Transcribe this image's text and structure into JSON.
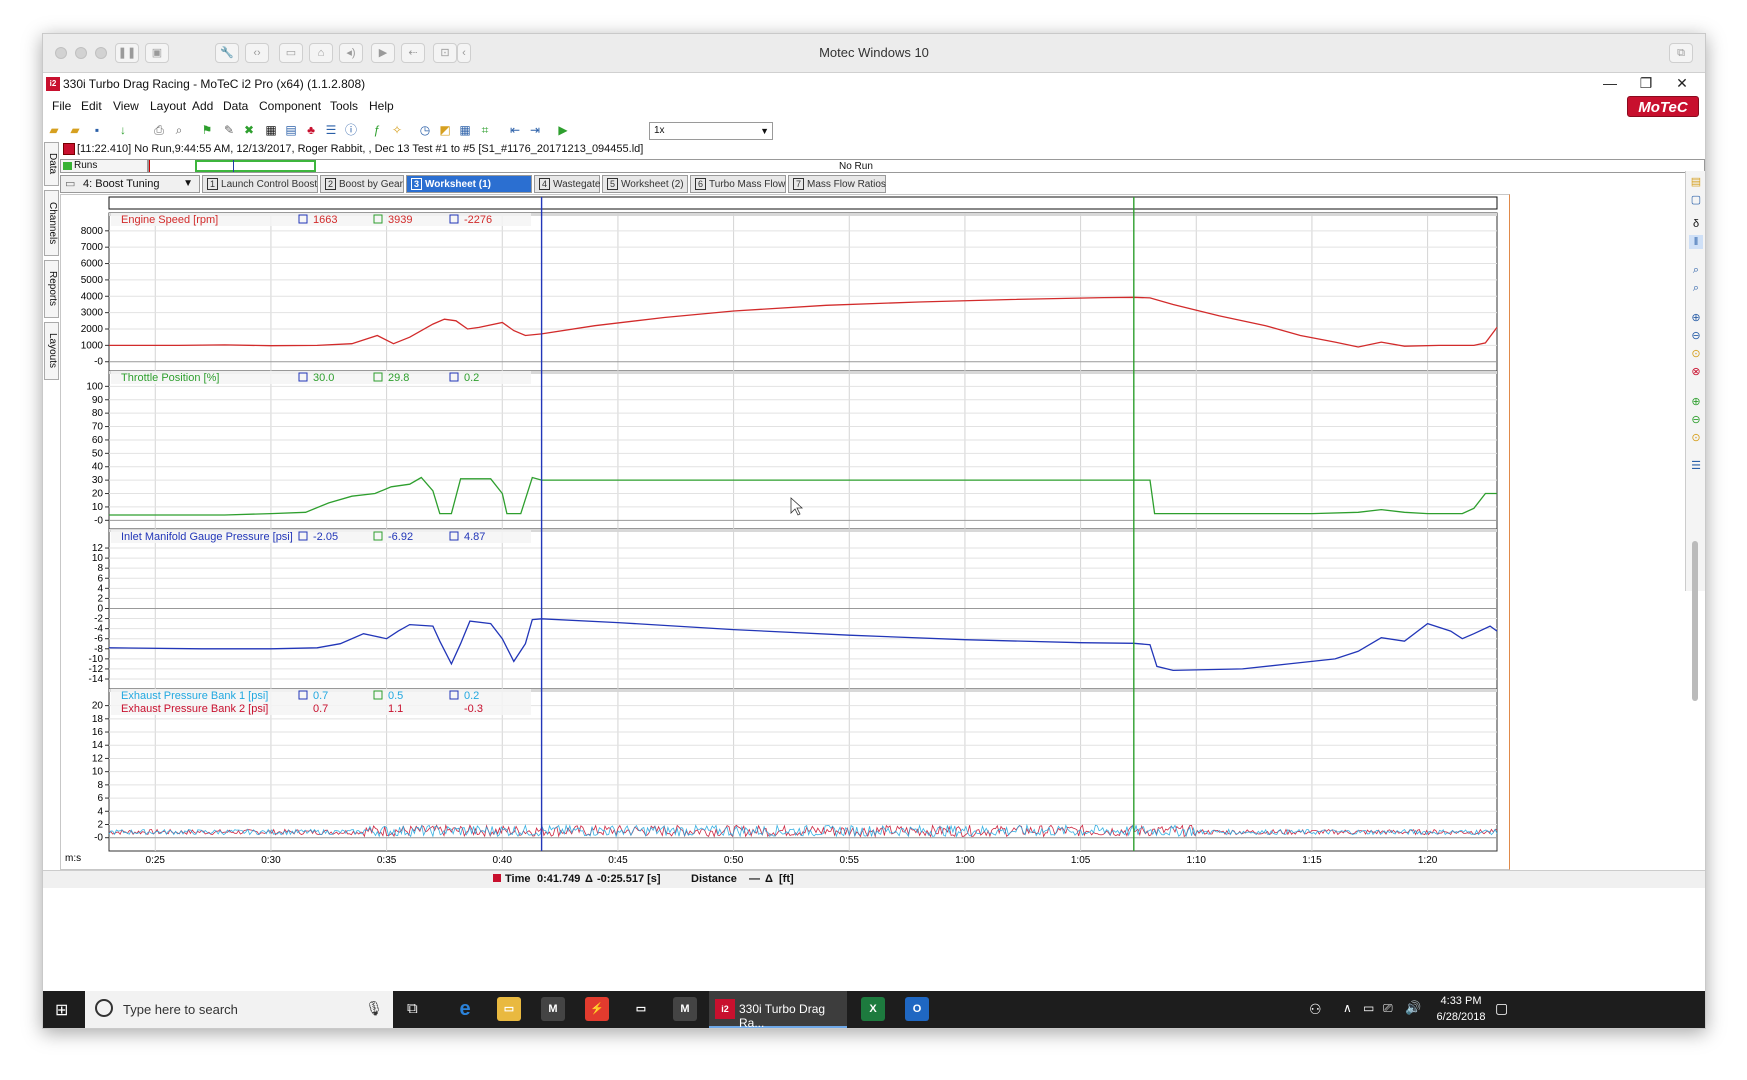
{
  "mac": {
    "title": "Motec Windows 10"
  },
  "window": {
    "title": "330i Turbo Drag Racing - MoTeC i2 Pro (x64) (1.1.2.808)",
    "logo": "MoTeC",
    "app_icon": "i2"
  },
  "menu": [
    "File",
    "Edit",
    "View",
    "Layout",
    "Add",
    "Data",
    "Component",
    "Tools",
    "Help"
  ],
  "toolbar": {
    "zoom": "1x"
  },
  "info": "[11:22.410] No Run,9:44:55 AM, 12/13/2017,  Roger Rabbit, , Dec 13 Test #1 to #5 [S1_#1176_20171213_094455.ld]",
  "left_tabs": [
    "Data",
    "Channels",
    "Reports",
    "Layouts"
  ],
  "runs": {
    "label": "Runs",
    "status": "No Run"
  },
  "worksheet_selector": "4: Boost Tuning",
  "tabs": [
    {
      "num": "1",
      "label": "Launch Control Boost",
      "active": false
    },
    {
      "num": "2",
      "label": "Boost by Gear",
      "active": false
    },
    {
      "num": "3",
      "label": "Worksheet (1)",
      "active": true
    },
    {
      "num": "4",
      "label": "Wastegate",
      "active": false
    },
    {
      "num": "5",
      "label": "Worksheet (2)",
      "active": false
    },
    {
      "num": "6",
      "label": "Turbo Mass Flow",
      "active": false
    },
    {
      "num": "7",
      "label": "Mass Flow Ratios",
      "active": false
    }
  ],
  "chart_data": {
    "type": "line",
    "x_unit": "m:s",
    "x_ticks": [
      "0:25",
      "0:30",
      "0:35",
      "0:40",
      "0:45",
      "0:50",
      "0:55",
      "1:00",
      "1:05",
      "1:10",
      "1:15",
      "1:20"
    ],
    "x_range": [
      "0:23",
      "1:23"
    ],
    "cursors": {
      "blue": "0:41.7",
      "green": "1:07.3"
    },
    "panes": [
      {
        "name": "Engine Speed [rpm]",
        "color": "#d22b2b",
        "cursor_a": "1663",
        "cursor_b": "3939",
        "delta": "-2276",
        "ylim": [
          -200,
          8600
        ],
        "y_ticks": [
          "8000",
          "7000",
          "6000",
          "5000",
          "4000",
          "3000",
          "2000",
          "1000",
          "-0"
        ],
        "points": [
          [
            23,
            1000
          ],
          [
            26,
            1000
          ],
          [
            28,
            1030
          ],
          [
            30,
            980
          ],
          [
            32,
            1000
          ],
          [
            33.5,
            1100
          ],
          [
            34.6,
            1600
          ],
          [
            35.3,
            1100
          ],
          [
            36,
            1500
          ],
          [
            37,
            2300
          ],
          [
            37.5,
            2600
          ],
          [
            38,
            2500
          ],
          [
            38.5,
            2000
          ],
          [
            39,
            2100
          ],
          [
            40,
            2400
          ],
          [
            40.5,
            1900
          ],
          [
            41,
            1600
          ],
          [
            41.7,
            1700
          ],
          [
            44,
            2200
          ],
          [
            47,
            2700
          ],
          [
            50,
            3100
          ],
          [
            54,
            3450
          ],
          [
            58,
            3650
          ],
          [
            62,
            3800
          ],
          [
            66,
            3920
          ],
          [
            67.3,
            3939
          ],
          [
            68,
            3900
          ],
          [
            69,
            3500
          ],
          [
            71,
            2800
          ],
          [
            73,
            2200
          ],
          [
            74.5,
            1600
          ],
          [
            76,
            1200
          ],
          [
            77,
            900
          ],
          [
            78,
            1200
          ],
          [
            79,
            950
          ],
          [
            80.5,
            1000
          ],
          [
            82,
            1000
          ],
          [
            82.5,
            1150
          ],
          [
            83,
            2100
          ]
        ]
      },
      {
        "name": "Throttle Position [%]",
        "color": "#2e9f2e",
        "cursor_a": "30.0",
        "cursor_b": "29.8",
        "delta": "0.2",
        "ylim": [
          -2,
          104
        ],
        "y_ticks": [
          "100",
          "90",
          "80",
          "70",
          "60",
          "50",
          "40",
          "30",
          "20",
          "10",
          "-0"
        ],
        "points": [
          [
            23,
            4
          ],
          [
            28,
            4
          ],
          [
            30,
            5
          ],
          [
            31.5,
            6
          ],
          [
            32.5,
            13
          ],
          [
            33.5,
            18
          ],
          [
            34.5,
            20
          ],
          [
            35.2,
            25
          ],
          [
            36,
            27
          ],
          [
            36.5,
            32
          ],
          [
            37,
            22
          ],
          [
            37.3,
            5
          ],
          [
            37.8,
            5
          ],
          [
            38.2,
            31
          ],
          [
            39.5,
            31
          ],
          [
            40,
            20
          ],
          [
            40.2,
            5
          ],
          [
            40.8,
            5
          ],
          [
            41.3,
            32
          ],
          [
            41.7,
            30
          ],
          [
            67.3,
            30
          ],
          [
            68,
            30
          ],
          [
            68.2,
            5
          ],
          [
            71,
            5
          ],
          [
            75,
            5
          ],
          [
            77,
            6
          ],
          [
            78,
            8
          ],
          [
            79,
            6
          ],
          [
            80,
            5
          ],
          [
            81.5,
            5
          ],
          [
            82,
            9
          ],
          [
            82.5,
            20
          ],
          [
            83,
            20
          ]
        ]
      },
      {
        "name": "Inlet Manifold Gauge Pressure [psi]",
        "color": "#2236b8",
        "cursor_a": "-2.05",
        "cursor_b": "-6.92",
        "delta": "4.87",
        "ylim": [
          -14,
          13
        ],
        "y_ticks": [
          "12",
          "10",
          "8",
          "6",
          "4",
          "2",
          "0",
          "-2",
          "-4",
          "-6",
          "-8",
          "-10",
          "-12",
          "-14"
        ],
        "points": [
          [
            23,
            -7.8
          ],
          [
            27,
            -8
          ],
          [
            30,
            -8
          ],
          [
            32,
            -7.8
          ],
          [
            33,
            -7
          ],
          [
            34,
            -5
          ],
          [
            35,
            -6
          ],
          [
            35.5,
            -4.5
          ],
          [
            36,
            -3.2
          ],
          [
            37,
            -3.5
          ],
          [
            37.3,
            -6.5
          ],
          [
            37.8,
            -11
          ],
          [
            38.2,
            -7
          ],
          [
            38.6,
            -2.5
          ],
          [
            39.5,
            -3
          ],
          [
            40,
            -6
          ],
          [
            40.5,
            -10.5
          ],
          [
            41,
            -7
          ],
          [
            41.3,
            -2.2
          ],
          [
            41.7,
            -2.05
          ],
          [
            45,
            -2.8
          ],
          [
            50,
            -4.2
          ],
          [
            55,
            -5.3
          ],
          [
            60,
            -6.2
          ],
          [
            65,
            -6.8
          ],
          [
            67.3,
            -6.92
          ],
          [
            68,
            -7.2
          ],
          [
            68.3,
            -11.5
          ],
          [
            69,
            -12.3
          ],
          [
            72,
            -12
          ],
          [
            74,
            -11
          ],
          [
            76,
            -10
          ],
          [
            77,
            -8.5
          ],
          [
            78,
            -5.8
          ],
          [
            79,
            -6.5
          ],
          [
            80,
            -3
          ],
          [
            81,
            -4.5
          ],
          [
            81.5,
            -6
          ],
          [
            82,
            -5
          ],
          [
            82.7,
            -3.5
          ],
          [
            83,
            -4.5
          ]
        ]
      },
      {
        "name": "Exhaust Pressure Bank 1 [psi]",
        "color": "#22a8e0",
        "cursor_a": "0.7",
        "cursor_b": "0.5",
        "delta": "0.2",
        "ylim": [
          -0.5,
          21
        ],
        "y_ticks": [
          "20",
          "18",
          "16",
          "14",
          "12",
          "10",
          "8",
          "6",
          "4",
          "2",
          "-0"
        ],
        "noise_level": 0.7
      },
      {
        "name": "Exhaust Pressure Bank 2 [psi]",
        "color": "#c8102e",
        "cursor_a": "0.7",
        "cursor_b": "1.1",
        "delta": "-0.3",
        "noise_level": 0.7
      }
    ]
  },
  "status": {
    "time_label": "Time",
    "time_value": "0:41.749",
    "delta_symbol": "Δ",
    "time_delta": "-0:25.517 [s]",
    "distance_label": "Distance",
    "distance_value": "—",
    "distance_delta": "Δ",
    "distance_unit": "[ft]"
  },
  "taskbar": {
    "search_placeholder": "Type here to search",
    "active_app": "330i Turbo Drag Ra...",
    "time": "4:33 PM",
    "date": "6/28/2018"
  },
  "icons": {
    "start": "windows-logo-icon",
    "mic": "microphone-icon",
    "taskview": "task-view-icon"
  }
}
